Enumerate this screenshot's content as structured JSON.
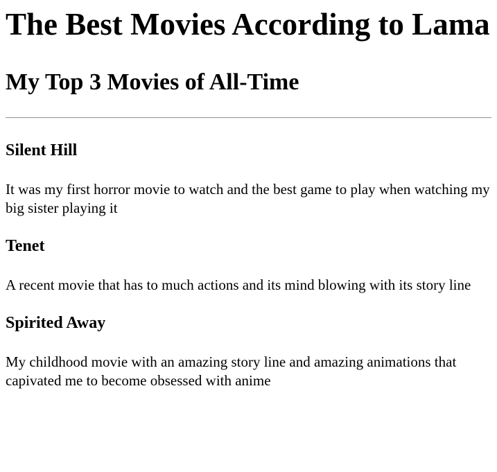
{
  "page": {
    "title": "The Best Movies According to Lama",
    "subtitle": "My Top 3 Movies of All-Time"
  },
  "movies": [
    {
      "title": "Silent Hill",
      "description": "It was my first horror movie to watch and the best game to play when watching my big sister playing it"
    },
    {
      "title": "Tenet",
      "description": "A recent movie that has to much actions and its mind blowing with its story line"
    },
    {
      "title": "Spirited Away",
      "description": "My childhood movie with an amazing story line and amazing animations that capivated me to become obsessed with anime"
    }
  ]
}
